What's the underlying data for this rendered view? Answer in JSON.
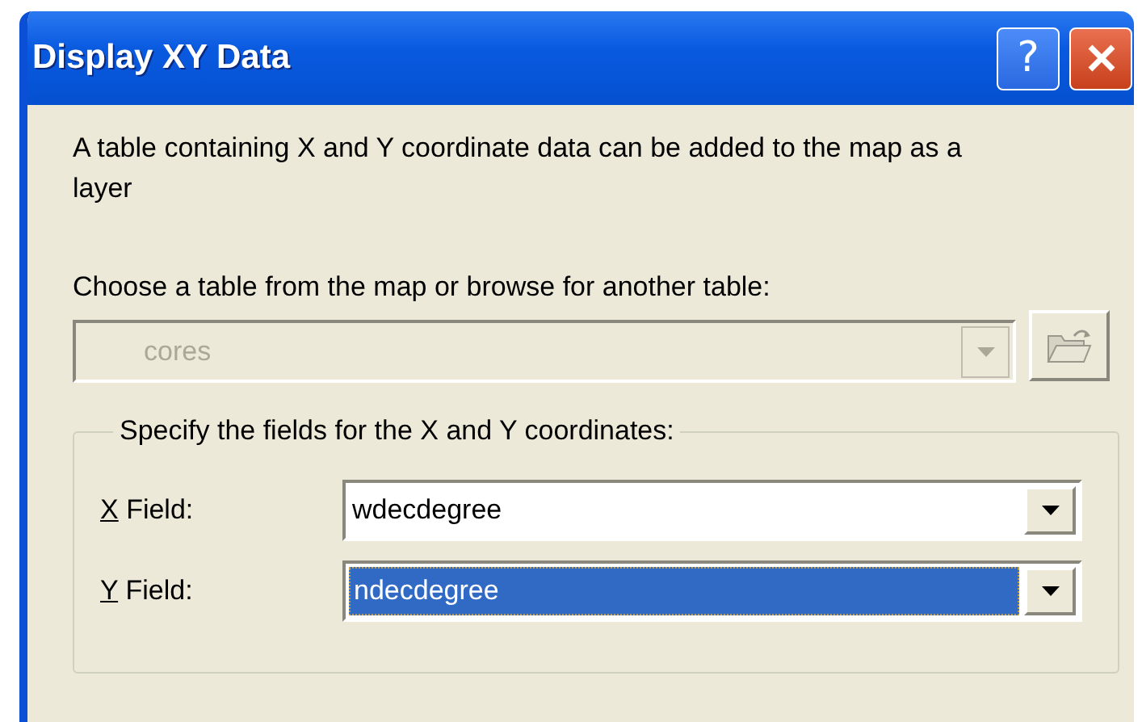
{
  "window": {
    "title": "Display XY Data",
    "buttons": [
      {
        "kind": "help",
        "label": "?"
      },
      {
        "kind": "close"
      }
    ]
  },
  "description": "A table containing X and Y coordinate data can be added to the map as a layer",
  "table_chooser": {
    "label": "Choose a table from the map or browse for another table:",
    "value": "cores",
    "disabled": true
  },
  "fields_group": {
    "legend": "Specify the fields for the X and Y coordinates:",
    "fields": [
      {
        "label": "X Field:",
        "value": "wdecdegree",
        "selected": false
      },
      {
        "label": "Y Field:",
        "value": "ndecdegree",
        "selected": true
      }
    ]
  }
}
